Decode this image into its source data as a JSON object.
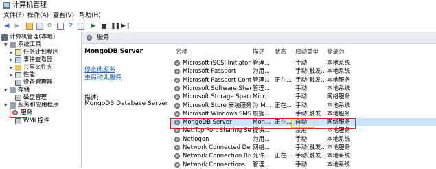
{
  "window": {
    "title": "计算机管理"
  },
  "menu": [
    "文件(F)",
    "操作(A)",
    "查看(V)",
    "帮助(H)"
  ],
  "toolbar": {
    "icons": [
      "back-arrow-icon",
      "forward-arrow-icon",
      "folder-up-icon",
      "properties-icon",
      "refresh-icon",
      "export-icon",
      "help-icon",
      "info-icon",
      "play-icon",
      "stop-icon",
      "pause-icon",
      "restart-icon"
    ]
  },
  "tree": {
    "root": "计算机管理(本地)",
    "system_tools": "系统工具",
    "task_scheduler": "任务计划程序",
    "event_viewer": "事件查看器",
    "shared_folders": "共享文件夹",
    "performance": "性能",
    "device_manager": "设备管理器",
    "storage": "存储",
    "disk_management": "磁盘管理",
    "services_apps": "服务和应用程序",
    "services": "服务",
    "wmi": "WMI 控件"
  },
  "header": {
    "title": "服务"
  },
  "detail": {
    "service_name": "MongoDB Server",
    "stop_link": "停止此服务",
    "restart_link": "重启动此服务",
    "desc_label": "描述:",
    "desc_text": "MongoDB Database Server"
  },
  "columns": {
    "name": "名称",
    "description": "描述",
    "status": "状态",
    "startup": "启动类型",
    "logon": "登录为"
  },
  "services": [
    {
      "name": "Microsoft iSCSI Initiator Ser...",
      "description": "管理...",
      "status": "",
      "startup": "手动",
      "logon": "本地系统"
    },
    {
      "name": "Microsoft Passport",
      "description": "为用...",
      "status": "",
      "startup": "手动(触发...",
      "logon": "本地系统"
    },
    {
      "name": "Microsoft Passport Container",
      "description": "管理...",
      "status": "正在...",
      "startup": "手动(触发...",
      "logon": "本地服务"
    },
    {
      "name": "Microsoft Software Shado...",
      "description": "管理...",
      "status": "",
      "startup": "手动",
      "logon": "本地系统"
    },
    {
      "name": "Microsoft Storage Spaces S...",
      "description": "Micr...",
      "status": "",
      "startup": "手动",
      "logon": "网络服务"
    },
    {
      "name": "Microsoft Store 安装服务",
      "description": "为 M...",
      "status": "正在...",
      "startup": "手动",
      "logon": "本地系统"
    },
    {
      "name": "Microsoft Windows SMS 路...",
      "description": "根据...",
      "status": "",
      "startup": "手动(触发...",
      "logon": "本地服务"
    },
    {
      "name": "MongoDB Server",
      "description": "Mon...",
      "status": "正在...",
      "startup": "自动",
      "logon": "网络服务"
    },
    {
      "name": "Net.Tcp Port Sharing Service",
      "description": "提供...",
      "status": "",
      "startup": "禁用",
      "logon": "本地服务"
    },
    {
      "name": "Netlogon",
      "description": "为用...",
      "status": "",
      "startup": "手动",
      "logon": "本地系统"
    },
    {
      "name": "Network Connected Devic...",
      "description": "网络...",
      "status": "",
      "startup": "手动(触发...",
      "logon": "本地服务"
    },
    {
      "name": "Network Connection Broker",
      "description": "允许...",
      "status": "正在...",
      "startup": "手动(触发...",
      "logon": "本地系统"
    },
    {
      "name": "Network Connections",
      "description": "管理...",
      "status": "",
      "startup": "手动",
      "logon": "本地系统"
    }
  ],
  "colors": {
    "highlight_red": "#e02424",
    "highlight_yellow": "#e8c100",
    "selection": "#cce4f7",
    "link": "#1a5fb4"
  }
}
